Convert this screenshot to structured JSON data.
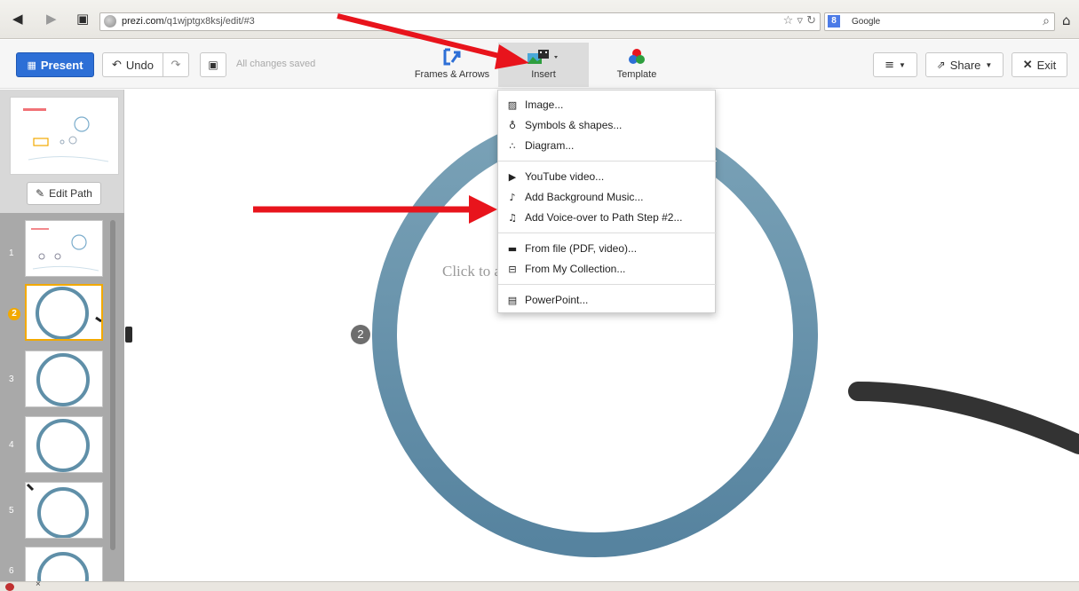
{
  "browser": {
    "url_domain": "prezi.com",
    "url_path": "/q1wjptgx8ksj/edit/#3",
    "search_engine": "Google",
    "search_logo_letter": "8"
  },
  "toolbar": {
    "present_label": "Present",
    "undo_label": "Undo",
    "saved_status": "All changes saved",
    "frames_label": "Frames & Arrows",
    "insert_label": "Insert",
    "template_label": "Template",
    "share_label": "Share",
    "exit_label": "Exit"
  },
  "sidebar": {
    "edit_path_label": "Edit Path",
    "steps": [
      {
        "num": "1",
        "active": false
      },
      {
        "num": "2",
        "active": true
      },
      {
        "num": "3",
        "active": false
      },
      {
        "num": "4",
        "active": false
      },
      {
        "num": "5",
        "active": false
      },
      {
        "num": "6",
        "active": false
      }
    ]
  },
  "canvas": {
    "placeholder": "Click to a",
    "path_badge": "2"
  },
  "insert_menu": {
    "items": [
      {
        "label": "Image...",
        "icon": "image-icon"
      },
      {
        "label": "Symbols & shapes...",
        "icon": "lightbulb-icon"
      },
      {
        "label": "Diagram...",
        "icon": "diagram-icon"
      },
      {
        "label": "YouTube video...",
        "icon": "youtube-icon"
      },
      {
        "label": "Add Background Music...",
        "icon": "music-file-icon"
      },
      {
        "label": "Add Voice-over to Path Step #2...",
        "icon": "music-note-icon"
      },
      {
        "label": "From file (PDF, video)...",
        "icon": "folder-icon"
      },
      {
        "label": "From My Collection...",
        "icon": "collection-icon"
      },
      {
        "label": "PowerPoint...",
        "icon": "powerpoint-icon"
      }
    ]
  },
  "colors": {
    "present_blue": "#2d6fd6",
    "active_step": "#f2a900",
    "ring_blue": "#5f8fa8",
    "annotation_arrow": "#e8141c"
  }
}
